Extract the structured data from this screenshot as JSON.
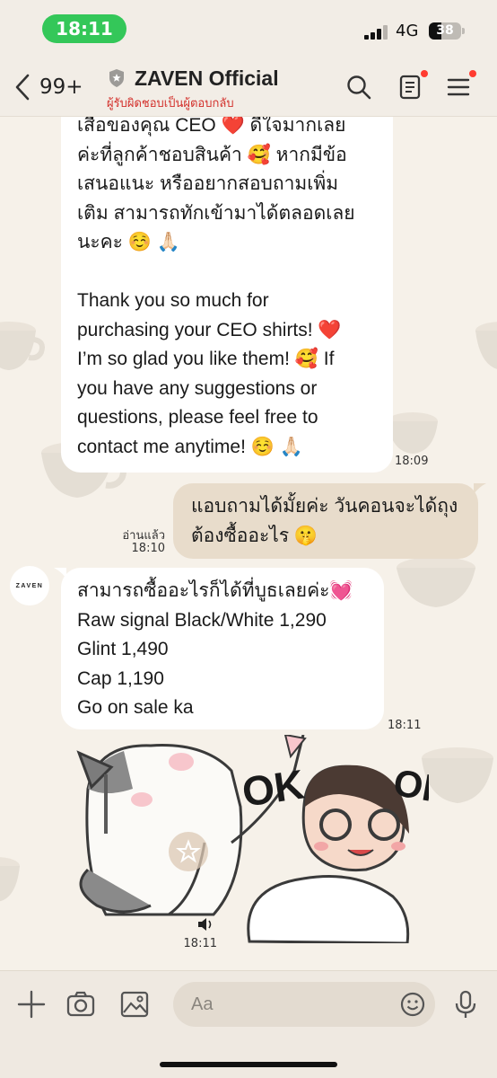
{
  "status_bar": {
    "time": "18:11",
    "network": "4G",
    "battery": "38",
    "battery_level": 0.38,
    "signal_bars": 3,
    "signal_bars_total": 4
  },
  "header": {
    "unread_count": "99+",
    "title": "ZAVEN Official",
    "subtitle": "ผู้รับผิดชอบเป็นผู้ตอบกลับ"
  },
  "messages": [
    {
      "sender": "ZAVEN",
      "text": "เสื้อของคุณ CEO ❤️ ดีใจมากเลย\nค่ะที่ลูกค้าชอบสินค้า 🥰 หากมีข้อ\nเสนอแนะ หรืออยากสอบถามเพิ่ม\nเติม สามารถทักเข้ามาได้ตลอดเลย\nนะคะ ☺️ 🙏🏻\n\nThank you so much for\npurchasing your CEO shirts! ❤️\nI’m so glad you like them! 🥰 If\nyou have any suggestions or\nquestions, please feel free to\ncontact me anytime! ☺️ 🙏🏻",
      "time": "18:09"
    },
    {
      "sender": "me",
      "text": "แอบถามได้มั้ยค่ะ วันคอนจะได้ถุง\nต้องซื้ออะไร 🤫",
      "read_label": "อ่านแล้ว",
      "time": "18:10"
    },
    {
      "sender": "ZAVEN",
      "avatar_text": "ZAVEN",
      "text": "สามารถซื้ออะไรก็ได้ที่บูธเลยค่ะ💓\nRaw signal Black/White 1,290\nGlint 1,490\nCap 1,190\nGo on sale ka",
      "time": "18:11"
    },
    {
      "sender": "ZAVEN",
      "type": "sticker",
      "sticker_text_left": "OK",
      "sticker_text_right": "OK",
      "time": "18:11"
    }
  ],
  "input_bar": {
    "placeholder": "Aa"
  },
  "icons": {
    "back": "chevron-left-icon",
    "verified": "shield-icon",
    "search": "search-icon",
    "notes": "notes-icon",
    "menu": "menu-icon",
    "add": "plus-icon",
    "camera": "camera-icon",
    "gallery": "image-icon",
    "emoji": "smiley-icon",
    "mic": "microphone-icon",
    "favorite": "star-icon",
    "sound": "speaker-icon"
  },
  "colors": {
    "time_pill": "#34c759",
    "subtitle": "#d3302b",
    "my_bubble": "#e8dccb",
    "their_bubble": "#ffffff",
    "notification_dot": "#ff3b30"
  }
}
